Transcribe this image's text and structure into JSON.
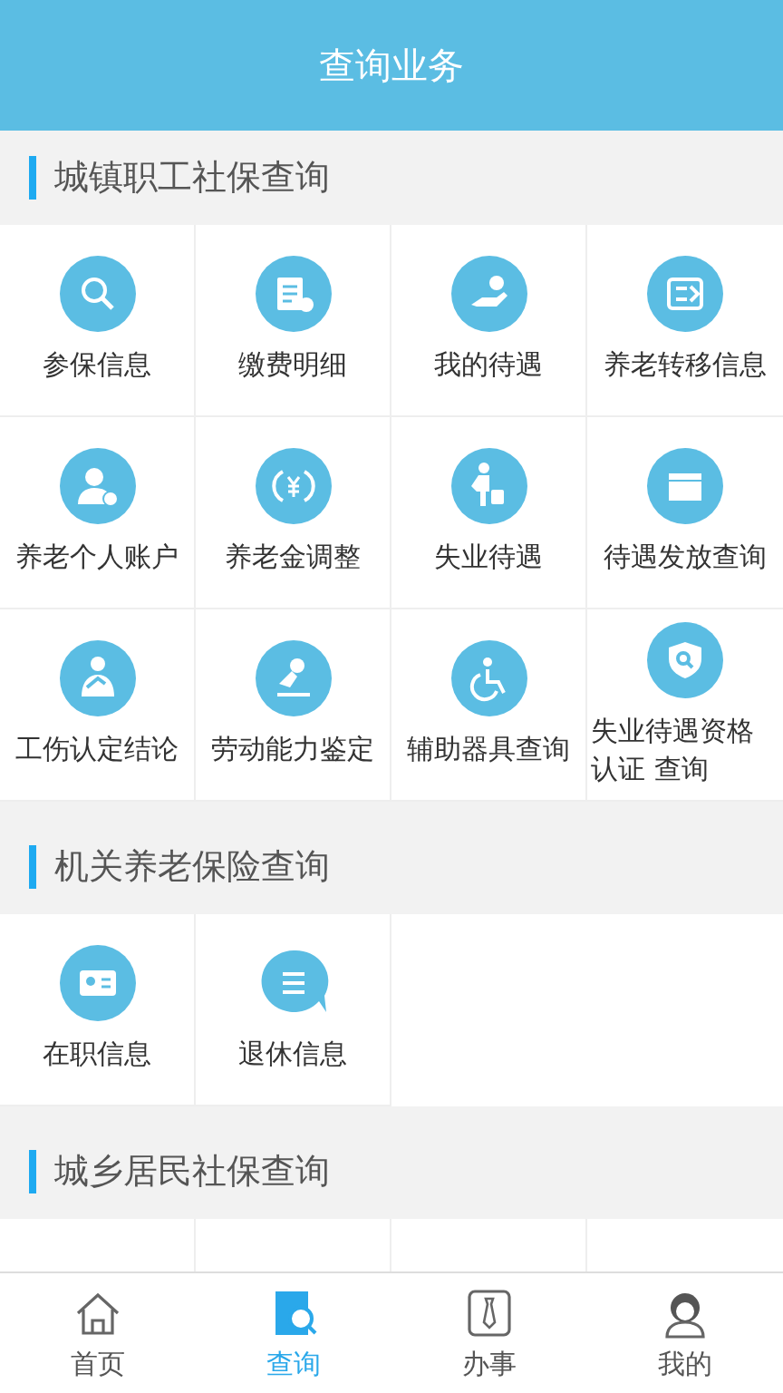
{
  "header": {
    "title": "查询业务"
  },
  "sections": [
    {
      "title": "城镇职工社保查询",
      "items": [
        {
          "label": "参保信息",
          "kind": "magnifier"
        },
        {
          "label": "缴费明细",
          "kind": "document"
        },
        {
          "label": "我的待遇",
          "kind": "hand-coin"
        },
        {
          "label": "养老转移信息",
          "kind": "transfer"
        },
        {
          "label": "养老个人账户",
          "kind": "person"
        },
        {
          "label": "养老金调整",
          "kind": "yuan"
        },
        {
          "label": "失业待遇",
          "kind": "walker"
        },
        {
          "label": "待遇发放查询",
          "kind": "box"
        },
        {
          "label": "工伤认定结论",
          "kind": "injured"
        },
        {
          "label": "劳动能力鉴定",
          "kind": "stamp"
        },
        {
          "label": "辅助器具查询",
          "kind": "wheelchair"
        },
        {
          "label": "失业待遇资格认证 查询",
          "kind": "shield"
        }
      ]
    },
    {
      "title": "机关养老保险查询",
      "items": [
        {
          "label": "在职信息",
          "kind": "card"
        },
        {
          "label": "退休信息",
          "kind": "chat"
        }
      ]
    },
    {
      "title": "城乡居民社保查询"
    }
  ],
  "tabs": [
    {
      "label": "首页",
      "kind": "home",
      "selected": false
    },
    {
      "label": "查询",
      "kind": "search",
      "selected": true
    },
    {
      "label": "办事",
      "kind": "tie",
      "selected": false
    },
    {
      "label": "我的",
      "kind": "user",
      "selected": false
    }
  ]
}
